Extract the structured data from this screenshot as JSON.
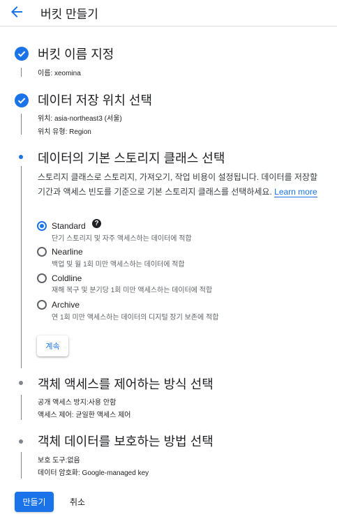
{
  "header": {
    "title": "버킷 만들기",
    "back_icon": "arrow-back-icon"
  },
  "steps": [
    {
      "status": "complete",
      "title": "버킷 이름 지정",
      "details": [
        "이름: xeomina"
      ]
    },
    {
      "status": "complete",
      "title": "데이터 저장 위치 선택",
      "details": [
        "위치: asia-northeast3 (서울)",
        "위치 유형: Region"
      ]
    },
    {
      "status": "active",
      "title": "데이터의 기본 스토리지 클래스 선택",
      "description": "스토리지 클래스로 스토리지, 가져오기, 작업 비용이 설정됩니다. 데이터를 저장할 기간과 액세스 빈도를 기준으로 기본 스토리지 클래스를 선택하세요.",
      "learn_more": "Learn more",
      "options": [
        {
          "label": "Standard",
          "description": "단기 스토리지 및 자주 액세스하는 데이터에 적합",
          "selected": true,
          "help": "?"
        },
        {
          "label": "Nearline",
          "description": "백업 및 월 1회 미만 액세스하는 데이터에 적합",
          "selected": false
        },
        {
          "label": "Coldline",
          "description": "재해 복구 및 분기당 1회 미만 액세스하는 데이터에 적합",
          "selected": false
        },
        {
          "label": "Archive",
          "description": "연 1회 미만 액세스하는 데이터의 디지털 장기 보존에 적합",
          "selected": false
        }
      ],
      "continue_label": "계속"
    },
    {
      "status": "pending",
      "title": "객체 액세스를 제어하는 방식 선택",
      "details": [
        "공개 액세스 방지:사용 안함",
        "액세스 제어: 균일한 액세스 제어"
      ]
    },
    {
      "status": "pending",
      "title": "객체 데이터를 보호하는 방법 선택",
      "details": [
        "보호 도구:없음",
        "데이터 암호화: Google-managed key"
      ]
    }
  ],
  "footer": {
    "create_label": "만들기",
    "cancel_label": "취소"
  },
  "colors": {
    "accent": "#1a73e8",
    "text": "#202124",
    "muted": "#5f6368"
  }
}
